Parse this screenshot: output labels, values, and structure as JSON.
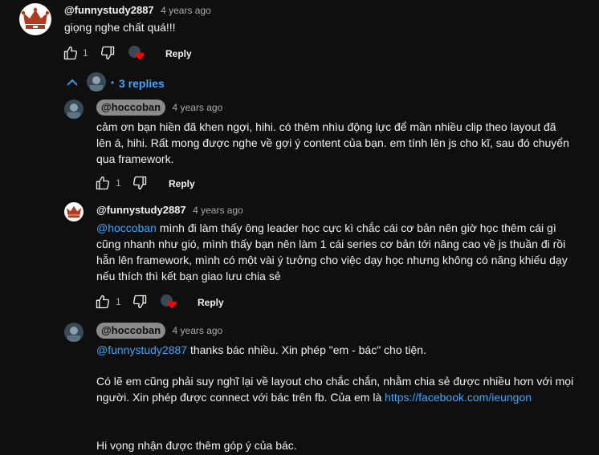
{
  "colors": {
    "background": "#0f0f0f",
    "text": "#f1f1f1",
    "muted": "#aaaaaa",
    "link": "#3ea6ff",
    "heart": "#ff0000"
  },
  "top_comment": {
    "author": "@funnystudy2887",
    "time": "4 years ago",
    "text": "giọng nghe chất quá!!!",
    "likes": "1",
    "reply_label": "Reply"
  },
  "replies_toggle": {
    "separator": "•",
    "label": "3 replies"
  },
  "replies": [
    {
      "author": "@hoccoban",
      "time": "4 years ago",
      "text": "cảm ơn bạn hiền đã khen ngợi, hihi. có thêm nhìu động lực để mần nhiều clip theo layout đã lên á, hihi. Rất mong được nghe về gợi ý content của bạn. em tính lên js cho kĩ, sau đó chuyển qua framework.",
      "likes": "1",
      "reply_label": "Reply"
    },
    {
      "author": "@funnystudy2887",
      "time": "4 years ago",
      "mention": "@hoccoban",
      "text": " mình đi làm thấy ông leader học cực kì chắc cái cơ bản nên giờ học thêm cái gì cũng nhanh như gió, mình thấy bạn nên làm 1 cái series cơ bản tới nâng cao về js thuần đi rồi hẵn lên framework, mình có một vài ý tưởng cho việc dạy học nhưng không có năng khiếu dạy nếu thích thì kết bạn giao lưu chia sẻ",
      "likes": "1",
      "reply_label": "Reply"
    },
    {
      "author": "@hoccoban",
      "time": "4 years ago",
      "mention": "@funnystudy2887",
      "text_line1": " thanks bác nhiều. Xin phép \"em - bác\" cho tiện.",
      "text_para2": "Có lẽ em cũng phải suy nghĩ lại về layout cho chắc chắn, nhằm chia sẻ được nhiều hơn với mọi người. Xin phép được connect với bác trên fb. Của em là ",
      "link": "https://facebook.com/ieungon",
      "text_para3": "Hi vọng nhận được thêm góp ý của bác."
    }
  ]
}
